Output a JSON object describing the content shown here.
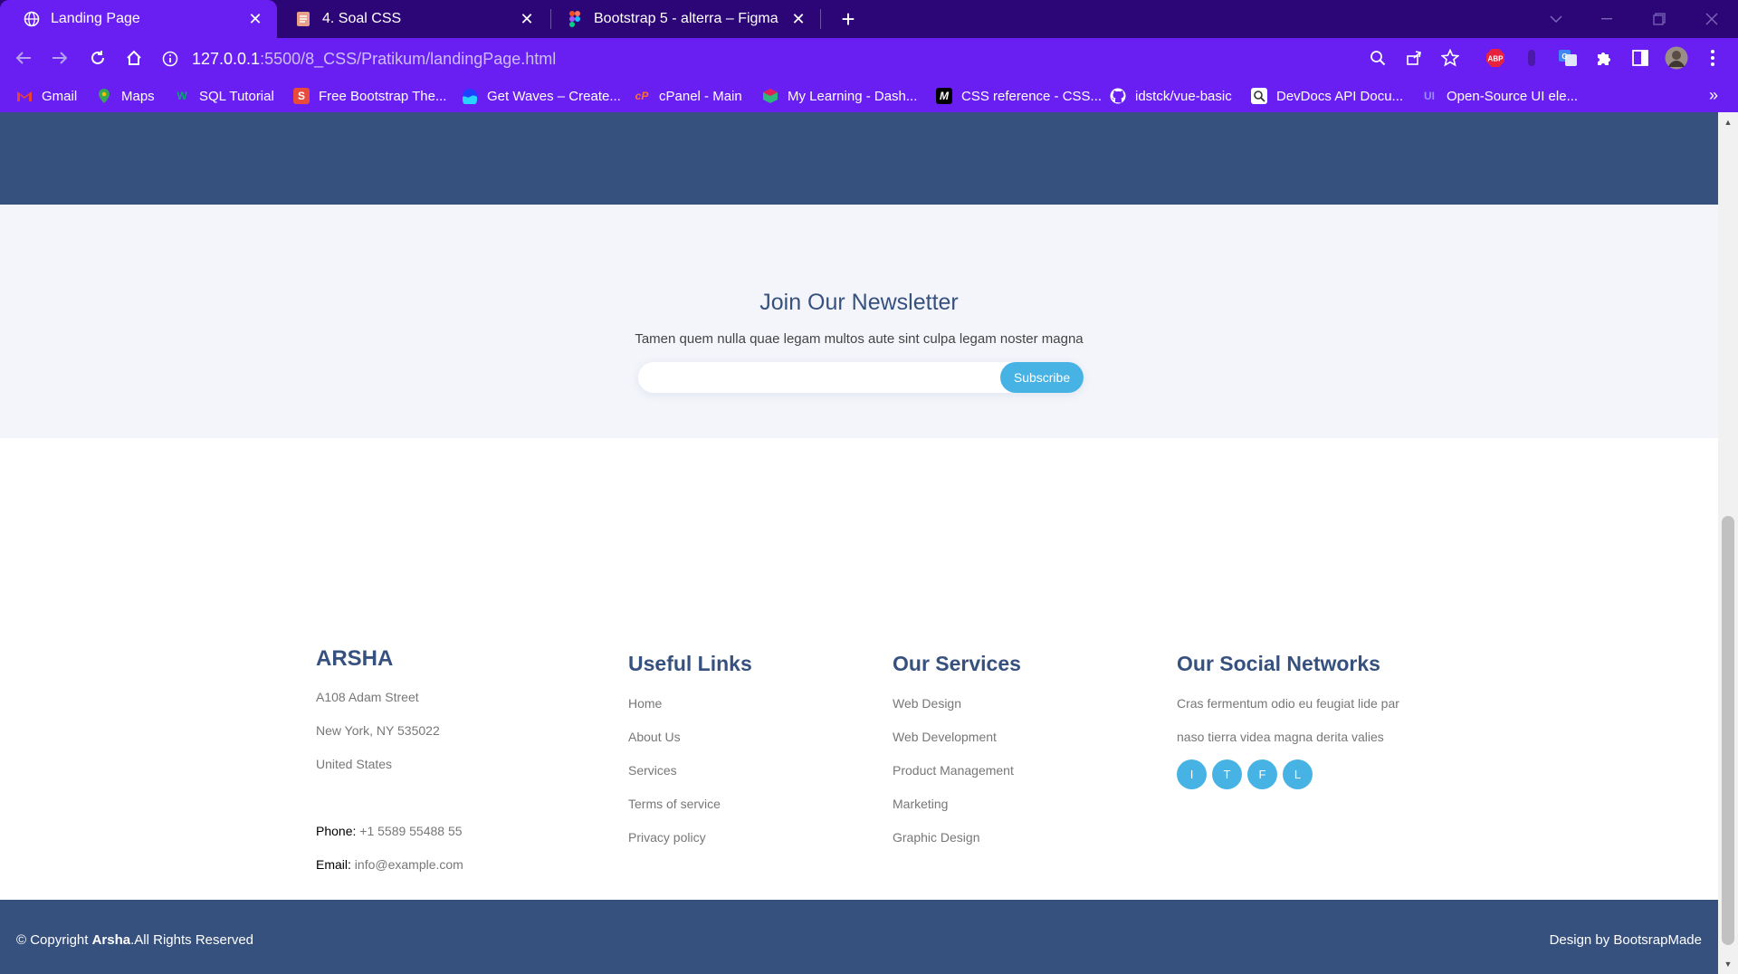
{
  "browser": {
    "tabs": [
      {
        "title": "Landing Page",
        "active": true
      },
      {
        "title": "4. Soal CSS",
        "active": false
      },
      {
        "title": "Bootstrap 5 - alterra – Figma",
        "active": false
      }
    ],
    "url_host": "127.0.0.1",
    "url_path": ":5500/8_CSS/Pratikum/landingPage.html",
    "bookmarks": [
      {
        "label": "Gmail",
        "icon": "gmail-icon"
      },
      {
        "label": "Maps",
        "icon": "maps-icon"
      },
      {
        "label": "SQL Tutorial",
        "icon": "w3schools-icon"
      },
      {
        "label": "Free Bootstrap The...",
        "icon": "s-icon"
      },
      {
        "label": "Get Waves – Create...",
        "icon": "waves-icon"
      },
      {
        "label": "cPanel - Main",
        "icon": "cpanel-icon"
      },
      {
        "label": "My Learning - Dash...",
        "icon": "learning-icon"
      },
      {
        "label": "CSS reference - CSS...",
        "icon": "m-icon"
      },
      {
        "label": "idstck/vue-basic",
        "icon": "github-icon"
      },
      {
        "label": "DevDocs API Docu...",
        "icon": "devdocs-icon"
      },
      {
        "label": "Open-Source UI ele...",
        "icon": "ui-icon"
      }
    ],
    "extension_abp": "ABP"
  },
  "newsletter": {
    "title": "Join Our Newsletter",
    "text": "Tamen quem nulla quae legam multos aute sint culpa legam noster magna",
    "input_placeholder": "",
    "button_label": "Subscribe"
  },
  "footer": {
    "brand": "ARSHA",
    "address": [
      "A108 Adam Street",
      "New York, NY 535022",
      "United States"
    ],
    "phone_label": "Phone:",
    "phone_value": " +1 5589 55488 55",
    "email_label": "Email:",
    "email_value": " info@example.com",
    "useful_links": {
      "title": "Useful Links",
      "items": [
        "Home",
        "About Us",
        "Services",
        "Terms of service",
        "Privacy policy"
      ]
    },
    "services": {
      "title": "Our Services",
      "items": [
        "Web Design",
        "Web Development",
        "Product Management",
        "Marketing",
        "Graphic Design"
      ]
    },
    "social": {
      "title": "Our Social Networks",
      "text_line1": "Cras fermentum odio eu feugiat lide par",
      "text_line2": "naso tierra videa magna derita valies",
      "buttons": [
        "I",
        "T",
        "F",
        "L"
      ]
    }
  },
  "copyright": {
    "prefix": "© Copyright ",
    "brand": "Arsha",
    "suffix": ".All Rights Reserved",
    "credit": "Design by BootsrapMade"
  },
  "colors": {
    "browser_dark": "#2c0677",
    "browser_accent": "#6a1ff2",
    "primary": "#37517e",
    "accent": "#47b2e4",
    "muted_bg": "#f3f5fa"
  }
}
